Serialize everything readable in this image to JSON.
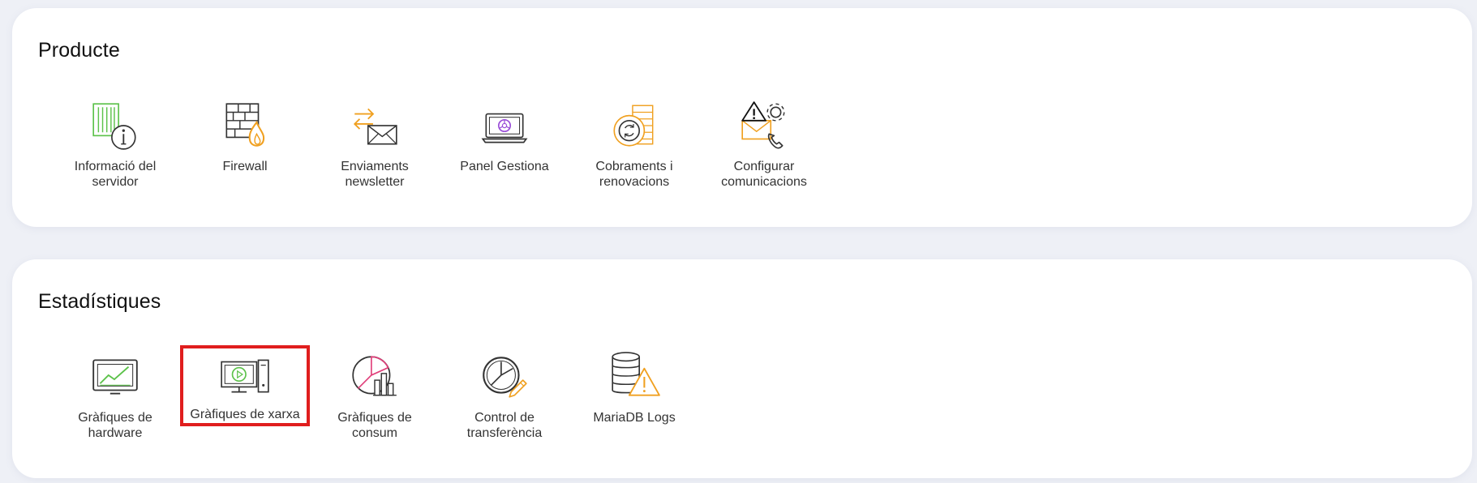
{
  "colors": {
    "background": "#eef0f6",
    "card": "#ffffff",
    "accent_orange": "#f0a020",
    "accent_green": "#5cc24a",
    "accent_purple": "#9b4fd8",
    "accent_pink": "#e0407a",
    "selection": "#e01e1e"
  },
  "sections": [
    {
      "title": "Producte",
      "items": [
        {
          "label": "Informació del servidor",
          "icon": "server-info-icon"
        },
        {
          "label": "Firewall",
          "icon": "firewall-icon"
        },
        {
          "label": "Enviaments newsletter",
          "icon": "newsletter-icon"
        },
        {
          "label": "Panel Gestiona",
          "icon": "panel-gestiona-icon"
        },
        {
          "label": "Cobraments i renovacions",
          "icon": "billing-renewals-icon"
        },
        {
          "label": "Configurar comunicacions",
          "icon": "configure-communications-icon"
        }
      ]
    },
    {
      "title": "Estadístiques",
      "items": [
        {
          "label": "Gràfiques de hardware",
          "icon": "hardware-chart-icon"
        },
        {
          "label": "Gràfiques de xarxa",
          "icon": "network-chart-icon",
          "selected": true
        },
        {
          "label": "Gràfiques de consum",
          "icon": "consumption-chart-icon"
        },
        {
          "label": "Control de transferència",
          "icon": "transfer-control-icon"
        },
        {
          "label": "MariaDB Logs",
          "icon": "mariadb-logs-icon"
        }
      ]
    }
  ]
}
